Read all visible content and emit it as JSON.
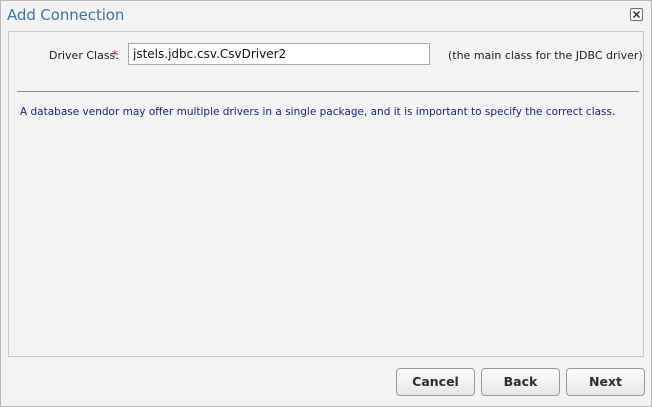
{
  "dialog": {
    "title": "Add Connection",
    "close_icon": "close-icon"
  },
  "form": {
    "driver_class_label": "Driver Class:",
    "required_marker": "*",
    "driver_class_value": "jstels.jdbc.csv.CsvDriver2",
    "driver_class_hint": "(the main class for the JDBC driver)"
  },
  "info_text": "A database vendor may offer multiple drivers in a single package, and it is important to specify the correct class.",
  "buttons": {
    "cancel": "Cancel",
    "back": "Back",
    "next": "Next"
  },
  "colors": {
    "title": "#3a73b0",
    "info_text": "#1a237e",
    "required": "#e02020"
  }
}
